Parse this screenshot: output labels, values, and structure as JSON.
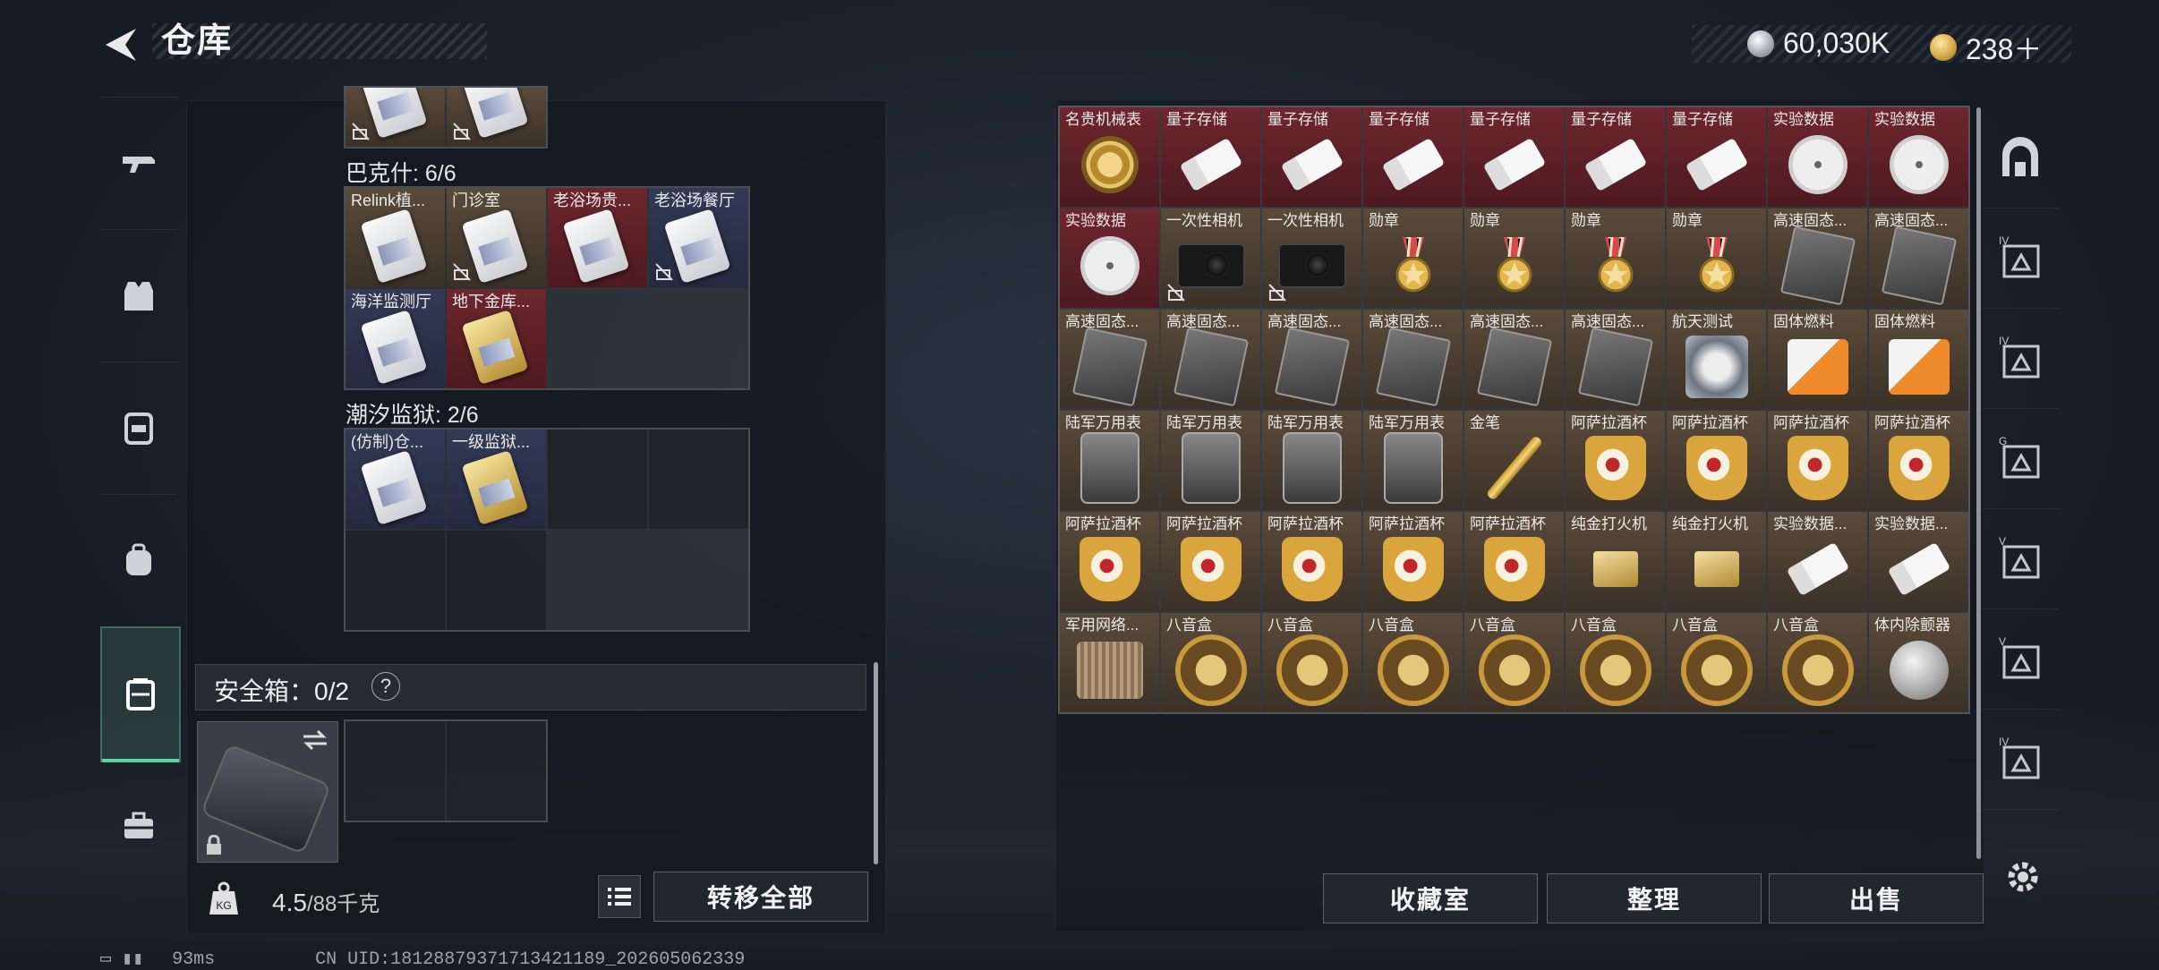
{
  "header": {
    "title": "仓库"
  },
  "currency": [
    {
      "icon": "silver-coin-icon",
      "value": "60,030K"
    },
    {
      "icon": "gold-coin-icon",
      "value": "238＋"
    }
  ],
  "left_nav": [
    "gun-icon",
    "vest-icon",
    "chest-rig-icon",
    "backpack-icon",
    "safe-case-icon",
    "toolbox-icon"
  ],
  "left_panel": {
    "top_partial_count": 2,
    "sections": [
      {
        "label": "巴克什: 6/6",
        "slots": [
          {
            "name": "Relink植...",
            "bg": "brown",
            "gold": false,
            "nolock": false
          },
          {
            "name": "门诊室",
            "bg": "brown",
            "gold": false,
            "nolock": true
          },
          {
            "name": "老浴场贵...",
            "bg": "red",
            "gold": false,
            "nolock": false
          },
          {
            "name": "老浴场餐厅",
            "bg": "navy",
            "gold": false,
            "nolock": true
          },
          {
            "name": "海洋监测厅",
            "bg": "navy",
            "gold": false,
            "nolock": false
          },
          {
            "name": "地下金库...",
            "bg": "red",
            "gold": true,
            "nolock": false
          }
        ]
      },
      {
        "label": "潮汐监狱: 2/6",
        "slots": [
          {
            "name": "(仿制)仓...",
            "bg": "navy",
            "gold": false,
            "nolock": false
          },
          {
            "name": "一级监狱...",
            "bg": "navy",
            "gold": true,
            "nolock": false
          }
        ]
      }
    ],
    "safe_box": {
      "label": "安全箱：0/2",
      "help": "?"
    },
    "weight": {
      "value": "4.5",
      "unit": "/88千克",
      "icon_label": "KG"
    },
    "transfer_all": "转移全部"
  },
  "stash_items": [
    {
      "name": "名贵机械表",
      "icon": "watch",
      "bg": "red"
    },
    {
      "name": "量子存储",
      "icon": "usb",
      "bg": "red"
    },
    {
      "name": "量子存储",
      "icon": "usb",
      "bg": "red"
    },
    {
      "name": "量子存储",
      "icon": "usb",
      "bg": "red"
    },
    {
      "name": "量子存储",
      "icon": "usb",
      "bg": "red"
    },
    {
      "name": "量子存储",
      "icon": "usb",
      "bg": "red"
    },
    {
      "name": "量子存储",
      "icon": "usb",
      "bg": "red"
    },
    {
      "name": "实验数据",
      "icon": "disc",
      "bg": "red"
    },
    {
      "name": "实验数据",
      "icon": "disc",
      "bg": "red"
    },
    {
      "name": "实验数据",
      "icon": "disc",
      "bg": "red"
    },
    {
      "name": "一次性相机",
      "icon": "camera",
      "bg": "brown",
      "nolock": true
    },
    {
      "name": "一次性相机",
      "icon": "camera",
      "bg": "brown",
      "nolock": true
    },
    {
      "name": "勋章",
      "icon": "medal",
      "bg": "brown"
    },
    {
      "name": "勋章",
      "icon": "medal",
      "bg": "brown"
    },
    {
      "name": "勋章",
      "icon": "medal",
      "bg": "brown"
    },
    {
      "name": "勋章",
      "icon": "medal",
      "bg": "brown"
    },
    {
      "name": "高速固态...",
      "icon": "ssd",
      "bg": "brown"
    },
    {
      "name": "高速固态...",
      "icon": "ssd",
      "bg": "brown"
    },
    {
      "name": "高速固态...",
      "icon": "ssd",
      "bg": "brown"
    },
    {
      "name": "高速固态...",
      "icon": "ssd",
      "bg": "brown"
    },
    {
      "name": "高速固态...",
      "icon": "ssd",
      "bg": "brown"
    },
    {
      "name": "高速固态...",
      "icon": "ssd",
      "bg": "brown"
    },
    {
      "name": "高速固态...",
      "icon": "ssd",
      "bg": "brown"
    },
    {
      "name": "高速固态...",
      "icon": "ssd",
      "bg": "brown"
    },
    {
      "name": "航天测试",
      "icon": "aero",
      "bg": "brown"
    },
    {
      "name": "固体燃料",
      "icon": "fuel",
      "bg": "brown"
    },
    {
      "name": "固体燃料",
      "icon": "fuel",
      "bg": "brown"
    },
    {
      "name": "陆军万用表",
      "icon": "watchbox",
      "bg": "brown"
    },
    {
      "name": "陆军万用表",
      "icon": "watchbox",
      "bg": "brown"
    },
    {
      "name": "陆军万用表",
      "icon": "watchbox",
      "bg": "brown"
    },
    {
      "name": "陆军万用表",
      "icon": "watchbox",
      "bg": "brown"
    },
    {
      "name": "金笔",
      "icon": "pen",
      "bg": "brown"
    },
    {
      "name": "阿萨拉酒杯",
      "icon": "goblet",
      "bg": "brown"
    },
    {
      "name": "阿萨拉酒杯",
      "icon": "goblet",
      "bg": "brown"
    },
    {
      "name": "阿萨拉酒杯",
      "icon": "goblet",
      "bg": "brown"
    },
    {
      "name": "阿萨拉酒杯",
      "icon": "goblet",
      "bg": "brown"
    },
    {
      "name": "阿萨拉酒杯",
      "icon": "goblet",
      "bg": "brown"
    },
    {
      "name": "阿萨拉酒杯",
      "icon": "goblet",
      "bg": "brown"
    },
    {
      "name": "阿萨拉酒杯",
      "icon": "goblet",
      "bg": "brown"
    },
    {
      "name": "阿萨拉酒杯",
      "icon": "goblet",
      "bg": "brown"
    },
    {
      "name": "阿萨拉酒杯",
      "icon": "goblet",
      "bg": "brown"
    },
    {
      "name": "纯金打火机",
      "icon": "lighter",
      "bg": "brown"
    },
    {
      "name": "纯金打火机",
      "icon": "lighter",
      "bg": "brown"
    },
    {
      "name": "实验数据...",
      "icon": "usb",
      "bg": "brown"
    },
    {
      "name": "实验数据...",
      "icon": "usb",
      "bg": "brown"
    },
    {
      "name": "军用网络...",
      "icon": "crate",
      "bg": "brown"
    },
    {
      "name": "八音盒",
      "icon": "musicbox",
      "bg": "brown"
    },
    {
      "name": "八音盒",
      "icon": "musicbox",
      "bg": "brown"
    },
    {
      "name": "八音盒",
      "icon": "musicbox",
      "bg": "brown"
    },
    {
      "name": "八音盒",
      "icon": "musicbox",
      "bg": "brown"
    },
    {
      "name": "八音盒",
      "icon": "musicbox",
      "bg": "brown"
    },
    {
      "name": "八音盒",
      "icon": "musicbox",
      "bg": "brown"
    },
    {
      "name": "八音盒",
      "icon": "musicbox",
      "bg": "brown"
    },
    {
      "name": "体内除颤器",
      "icon": "debug",
      "bg": "brown"
    }
  ],
  "right_actions": {
    "collection": "收藏室",
    "organize": "整理",
    "sell": "出售"
  },
  "right_nav": [
    {
      "icon": "storage-room-icon",
      "label": ""
    },
    {
      "icon": "stash-tab-icon",
      "label": "IV"
    },
    {
      "icon": "stash-tab-icon",
      "label": "IV"
    },
    {
      "icon": "stash-tab-icon",
      "label": "G"
    },
    {
      "icon": "stash-tab-icon",
      "label": "V"
    },
    {
      "icon": "stash-tab-icon",
      "label": "V"
    },
    {
      "icon": "stash-tab-icon",
      "label": "IV"
    }
  ],
  "status_bar": {
    "ping": "93ms",
    "uid": "CN UID:18128879371713421189_202605062339"
  }
}
